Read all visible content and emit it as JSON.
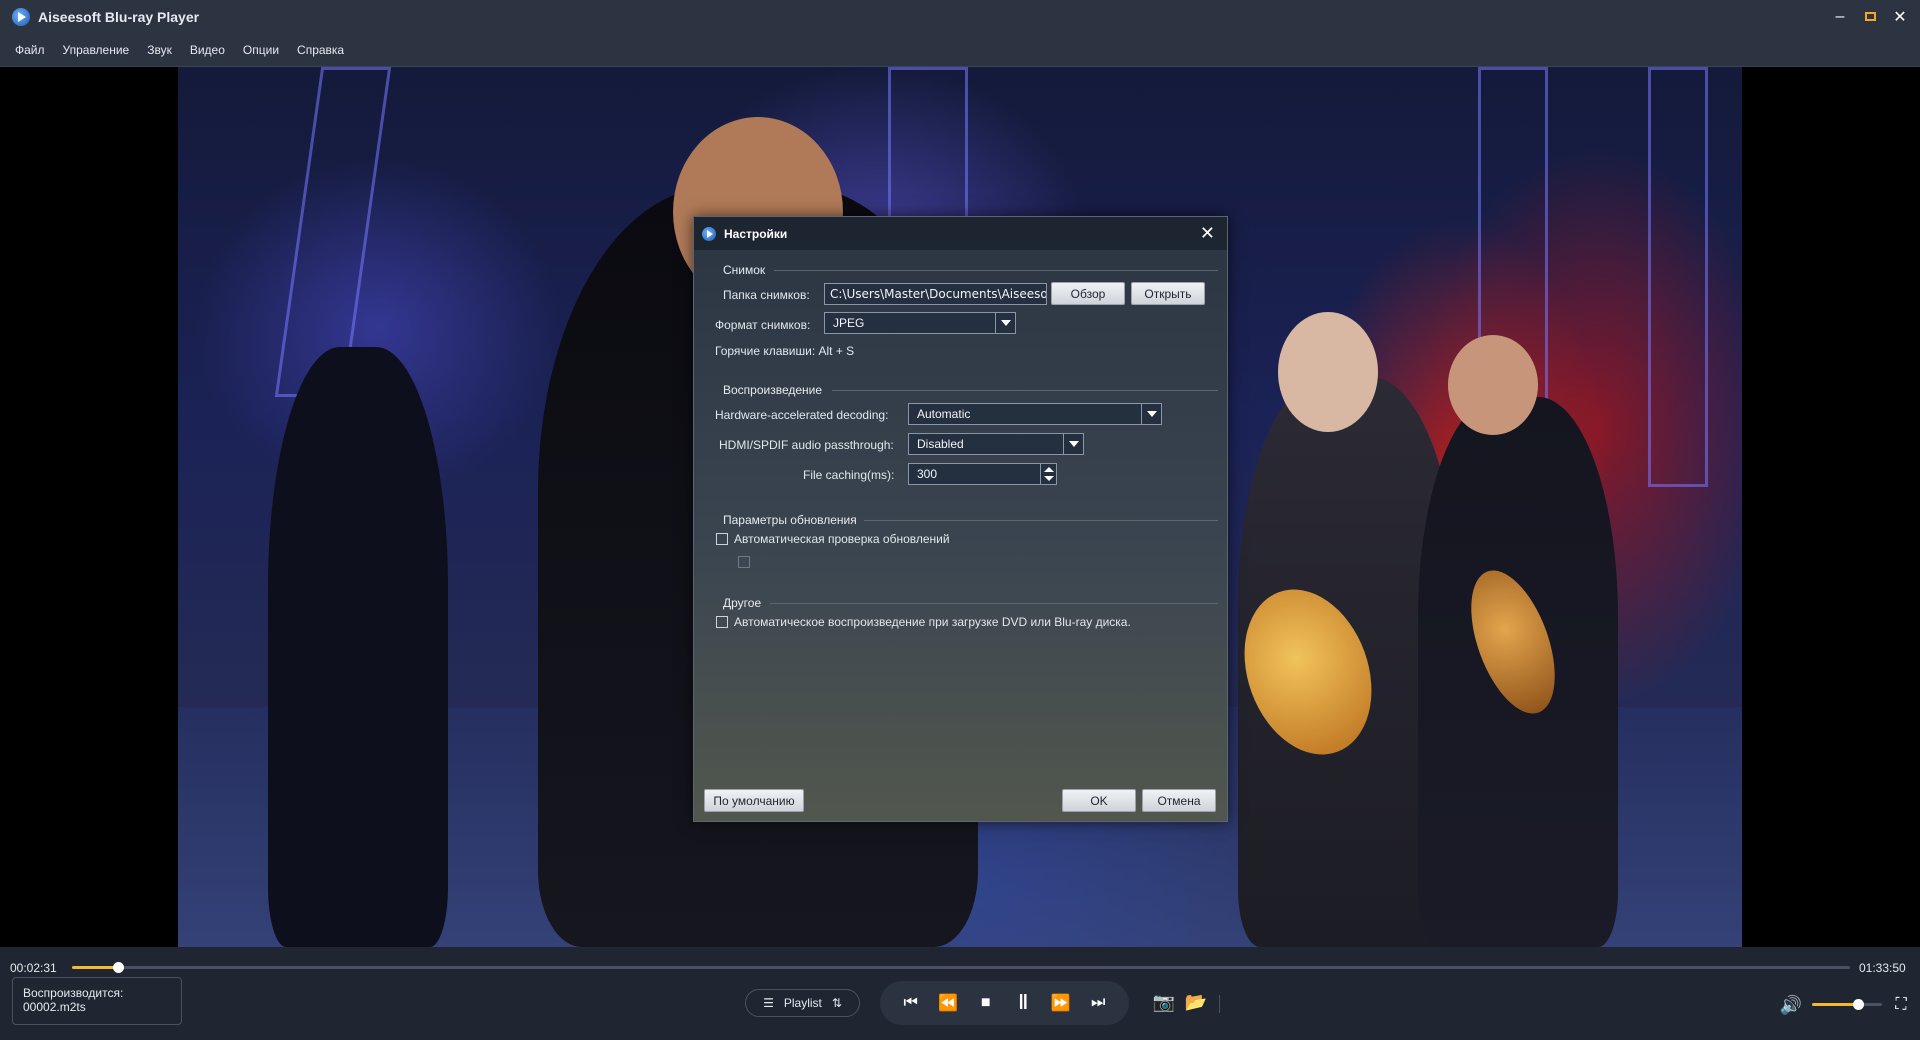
{
  "app": {
    "title": "Aiseesoft Blu-ray Player"
  },
  "menu": [
    "Файл",
    "Управление",
    "Звук",
    "Видео",
    "Опции",
    "Справка"
  ],
  "dialog": {
    "title": "Настройки",
    "snapshot": {
      "group": "Снимок",
      "folder_label": "Папка снимков:",
      "folder_value": "C:\\Users\\Master\\Documents\\Aiseesoft",
      "browse_button": "Обзор",
      "open_button": "Открыть",
      "format_label": "Формат снимков:",
      "format_value": "JPEG",
      "hotkey_text": "Горячие клавиши: Alt + S"
    },
    "playback": {
      "group": "Воспроизведение",
      "hw_label": "Hardware-accelerated decoding:",
      "hw_value": "Automatic",
      "hdmi_label": "HDMI/SPDIF audio passthrough:",
      "hdmi_value": "Disabled",
      "cache_label": "File caching(ms):",
      "cache_value": "300"
    },
    "updates": {
      "group": "Параметры обновления",
      "auto_check_label": "Автоматическая проверка обновлений",
      "auto_check_checked": false,
      "sub_option_checked": false
    },
    "other": {
      "group": "Другое",
      "autoplay_label": "Автоматическое воспроизведение при загрузке DVD или Blu-ray диска.",
      "autoplay_checked": false
    },
    "default_button": "По умолчанию",
    "ok_button": "OK",
    "cancel_button": "Отмена"
  },
  "player": {
    "current_time": "00:02:31",
    "total_time": "01:33:50",
    "progress_fraction": 0.026,
    "now_playing_label": "Воспроизводится:",
    "now_playing_file": "00002.m2ts",
    "playlist_label": "Playlist",
    "volume_fraction": 0.66,
    "accent_color": "#f5b82e"
  }
}
